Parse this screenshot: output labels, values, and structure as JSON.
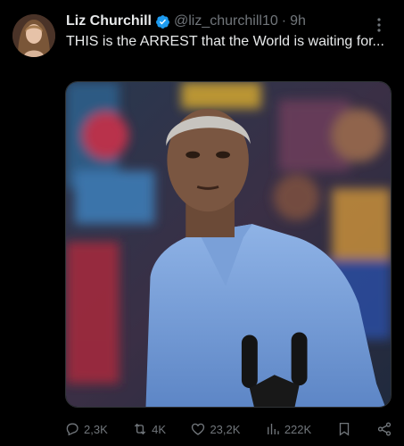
{
  "post": {
    "author": {
      "name": "Liz Churchill",
      "handle": "@liz_churchill10",
      "verified": true
    },
    "timestamp": "9h",
    "separator": "·",
    "text": "THIS is the ARREST that the World is waiting for...",
    "media_type": "photo"
  },
  "actions": {
    "replies": "2,3K",
    "reposts": "4K",
    "likes": "23,2K",
    "views": "222K"
  },
  "icons": {
    "more": "more-options-icon",
    "reply": "reply-icon",
    "repost": "repost-icon",
    "like": "heart-icon",
    "views": "views-chart-icon",
    "bookmark": "bookmark-icon",
    "share": "share-icon",
    "verified": "verified-badge-icon"
  },
  "colors": {
    "background": "#000000",
    "text_primary": "#e7e9ea",
    "text_secondary": "#71767b",
    "verified": "#1d9bf0"
  }
}
